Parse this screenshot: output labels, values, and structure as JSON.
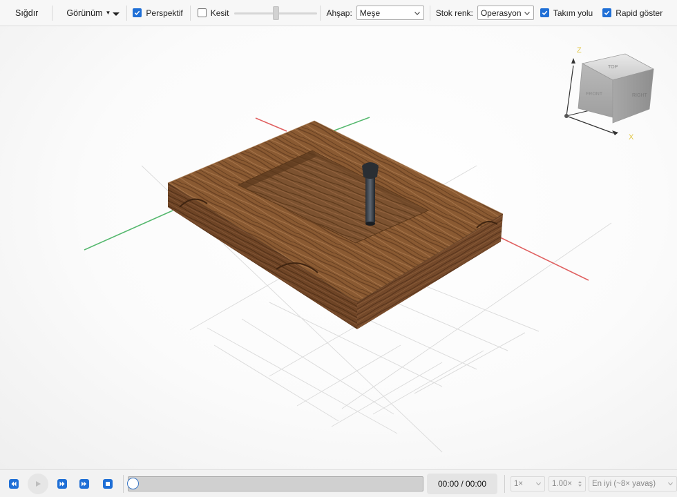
{
  "toolbar": {
    "fit_label": "Sığdır",
    "view_label": "Görünüm",
    "perspective_label": "Perspektif",
    "perspective_checked": true,
    "section_label": "Kesit",
    "section_checked": false,
    "wood_label": "Ahşap:",
    "wood_value": "Meşe",
    "stock_color_label": "Stok renk:",
    "stock_color_value": "Operasyon",
    "toolpath_label": "Takım yolu",
    "toolpath_checked": true,
    "rapid_label": "Rapid göster",
    "rapid_checked": true
  },
  "viewcube": {
    "axis_z": "Z",
    "axis_x": "X",
    "face_top": "TOP",
    "face_front": "FRONT",
    "face_right": "RIGHT"
  },
  "playback": {
    "time": "00:00 / 00:00",
    "progress": 0,
    "speed_value": "1×",
    "speed_multiplier": "1.00×",
    "quality_value": "En iyi (~8× yavaş)"
  },
  "colors": {
    "accent": "#1f6fd6",
    "axis_x": "#e06060",
    "axis_y": "#55b86e",
    "wood": "#8a5a32"
  }
}
